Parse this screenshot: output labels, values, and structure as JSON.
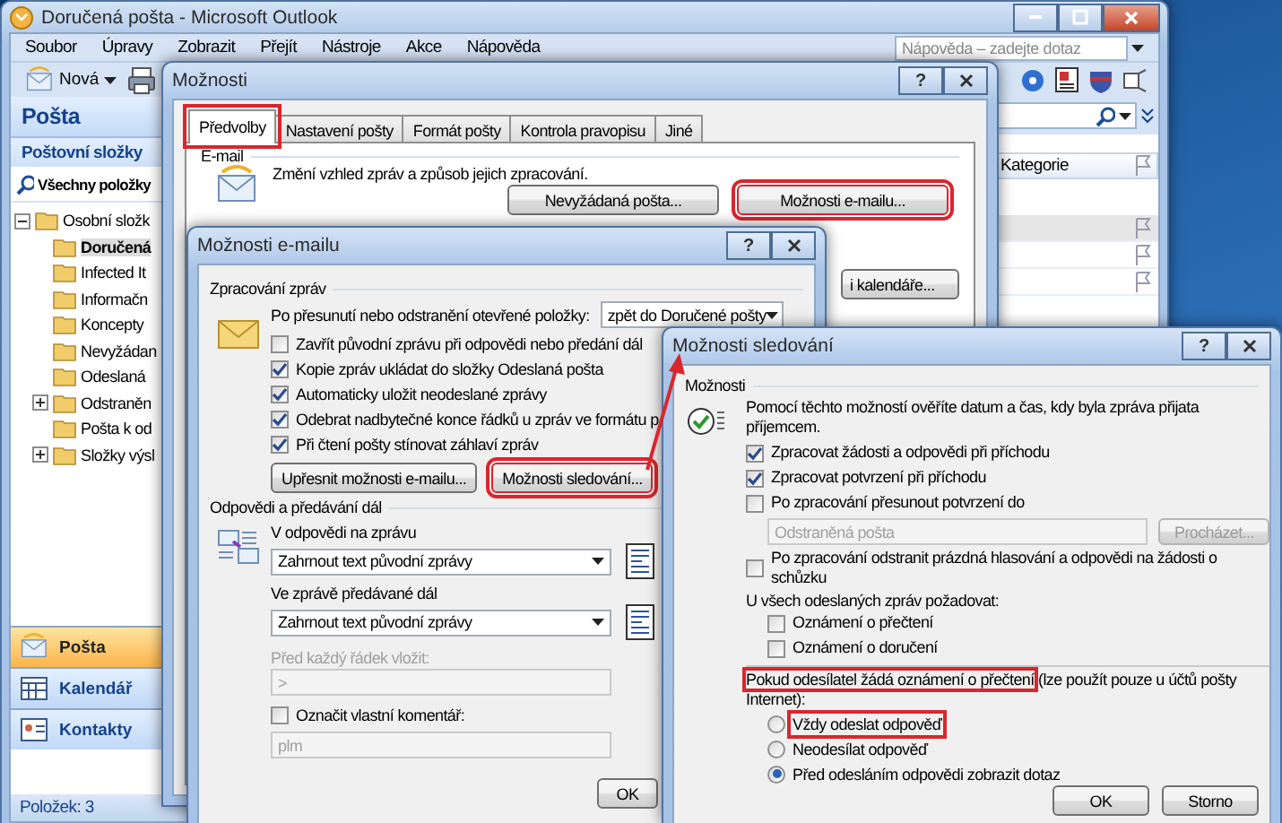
{
  "window": {
    "title": "Doručená pošta - Microsoft Outlook"
  },
  "menu": [
    "Soubor",
    "Úpravy",
    "Zobrazit",
    "Přejít",
    "Nástroje",
    "Akce",
    "Nápověda"
  ],
  "help_search": {
    "placeholder": "Nápověda – zadejte dotaz"
  },
  "toolbar": {
    "new_button": "Nová"
  },
  "navigation": {
    "title": "Pošta",
    "section": "Poštovní složky",
    "all_items": "Všechny položky",
    "folders": [
      {
        "label": "Osobní složk",
        "expanded": true,
        "selected": false,
        "children": [
          {
            "label": "Doručená",
            "selected": true
          },
          {
            "label": "Infected It",
            "selected": false
          },
          {
            "label": "Informačn",
            "selected": false
          },
          {
            "label": "Koncepty",
            "selected": false
          },
          {
            "label": "Nevyžádan",
            "selected": false
          },
          {
            "label": "Odeslaná",
            "selected": false
          },
          {
            "label": "Odstraněn",
            "selected": false,
            "expanded": false
          },
          {
            "label": "Pošta k od",
            "selected": false
          },
          {
            "label": "Složky výsl",
            "selected": false,
            "expanded": false
          }
        ]
      }
    ],
    "buttons": [
      {
        "label": "Pošta",
        "selected": true
      },
      {
        "label": "Kalendář",
        "selected": false
      },
      {
        "label": "Kontakty",
        "selected": false
      }
    ]
  },
  "list": {
    "column": "Kategorie"
  },
  "status_bar": "Položek: 3",
  "options_dialog": {
    "title": "Možnosti",
    "help_button": "?",
    "tabs": [
      {
        "label": "Předvolby",
        "selected": true,
        "highlighted": true
      },
      {
        "label": "Nastavení pošty",
        "selected": false,
        "highlighted": false
      },
      {
        "label": "Formát pošty",
        "selected": false,
        "highlighted": false
      },
      {
        "label": "Kontrola pravopisu",
        "selected": false,
        "highlighted": false
      },
      {
        "label": "Jiné",
        "selected": false,
        "highlighted": false
      }
    ],
    "email_group": "E-mail",
    "email_text": "Změní vzhled zpráv a způsob jejich zpracování.",
    "buttons": [
      {
        "label": "Nevyžádaná pošta...",
        "highlighted": false
      },
      {
        "label": "Možnosti e-mailu...",
        "highlighted": true
      }
    ],
    "calendar_button": "i kalendáře..."
  },
  "email_dialog": {
    "title": "Možnosti e-mailu",
    "help_button": "?",
    "processing": {
      "title": "Zpracování zpráv",
      "move_label": "Po přesunutí nebo odstranění otevřené položky:",
      "move_value": "zpět do Doručené pošty",
      "checkboxes": [
        {
          "label": "Zavřít původní zprávu při odpovědi nebo předání dál",
          "checked": false
        },
        {
          "label": "Kopie zpráv ukládat do složky Odeslaná pošta",
          "checked": true
        },
        {
          "label": "Automaticky uložit neodeslané zprávy",
          "checked": true
        },
        {
          "label": "Odebrat nadbytečné konce řádků u zpráv ve formátu p",
          "checked": true
        },
        {
          "label": "Při čtení pošty stínovat záhlaví zpráv",
          "checked": true
        }
      ],
      "buttons": [
        {
          "label": "Upřesnit možnosti e-mailu...",
          "highlighted": false
        },
        {
          "label": "Možnosti sledování...",
          "highlighted": true
        }
      ]
    },
    "replies": {
      "title": "Odpovědi a předávání dál",
      "reply_label": "V odpovědi na zprávu",
      "reply_value": "Zahrnout text původní zprávy",
      "forward_label": "Ve zprávě předávané dál",
      "forward_value": "Zahrnout text původní zprávy",
      "prefix_label": "Před každý řádek vložit:",
      "prefix_value": ">",
      "prefix_disabled": true,
      "comment": {
        "label": "Označit vlastní komentář:",
        "checked": false
      },
      "comment_value": "plm",
      "comment_disabled": true
    },
    "ok": "OK"
  },
  "tracking_dialog": {
    "title": "Možnosti sledování",
    "help_button": "?",
    "group": "Možnosti",
    "description": "Pomocí těchto možností ověříte datum a čas, kdy byla zpráva přijata příjemcem.",
    "items": [
      {
        "kind": "checkbox",
        "label": "Zpracovat žádosti a odpovědi při příchodu",
        "checked": true
      },
      {
        "kind": "checkbox",
        "label": "Zpracovat potvrzení při příchodu",
        "checked": true
      },
      {
        "kind": "checkbox",
        "label": "Po zpracování přesunout potvrzení do",
        "checked": false
      },
      {
        "kind": "folder",
        "value": "Odstraněná pošta",
        "button": "Procházet...",
        "disabled": true
      },
      {
        "kind": "checkbox",
        "label": "Po zpracování odstranit prázdná hlasování a odpovědi na žádosti o schůzku",
        "checked": false
      },
      {
        "kind": "label",
        "label": "U všech odeslaných zpráv požadovat:",
        "children": [
          {
            "kind": "checkbox",
            "label": "Oznámení o přečtení",
            "checked": false
          },
          {
            "kind": "checkbox",
            "label": "Oznámení o doručení",
            "checked": false
          }
        ]
      }
    ],
    "read_receipt": {
      "text": "Pokud odesílatel žádá oznámení o přečtení",
      "note": "(lze použít pouze u účtů pošty Internet):",
      "highlighted": true
    },
    "radios": [
      {
        "label": "Vždy odeslat odpověď",
        "selected": false,
        "highlighted": true
      },
      {
        "label": "Neodesílat odpověď",
        "selected": false,
        "highlighted": false
      },
      {
        "label": "Před odesláním odpovědi zobrazit dotaz",
        "selected": true,
        "highlighted": false
      }
    ],
    "buttons": [
      "OK",
      "Storno"
    ]
  },
  "annotation_arrow": true
}
